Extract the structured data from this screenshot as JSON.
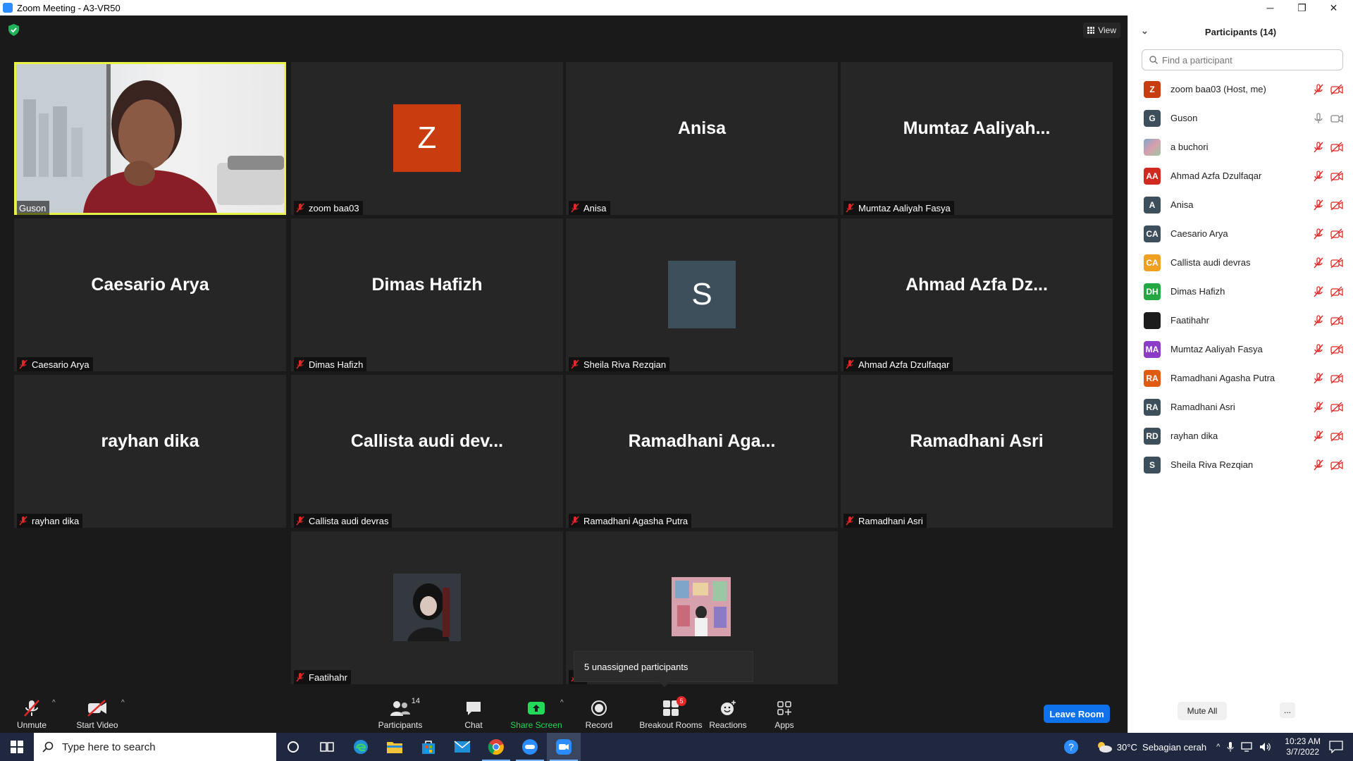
{
  "window": {
    "title": "Zoom Meeting - A3-VR50",
    "controls": [
      "─",
      "❐",
      "✕"
    ]
  },
  "view_button": {
    "label": "View"
  },
  "tiles": [
    {
      "label": "Guson",
      "big_name": "",
      "type": "video",
      "active": true
    },
    {
      "label": "zoom baa03",
      "big_name": "",
      "type": "avatar",
      "avatar_letter": "Z",
      "avatar_color": "#c83c10"
    },
    {
      "label": "Anisa",
      "big_name": "Anisa",
      "type": "name"
    },
    {
      "label": "Mumtaz Aaliyah Fasya",
      "big_name": "Mumtaz  Aaliyah...",
      "type": "name"
    },
    {
      "label": "Caesario Arya",
      "big_name": "Caesario Arya",
      "type": "name"
    },
    {
      "label": "Dimas Hafizh",
      "big_name": "Dimas Hafizh",
      "type": "name"
    },
    {
      "label": "Sheila Riva Rezqian",
      "big_name": "",
      "type": "avatar",
      "avatar_letter": "S",
      "avatar_color": "#3e4f5c"
    },
    {
      "label": "Ahmad Azfa Dzulfaqar",
      "big_name": "Ahmad  Azfa  Dz...",
      "type": "name"
    },
    {
      "label": "rayhan dika",
      "big_name": "rayhan dika",
      "type": "name"
    },
    {
      "label": "Callista audi devras",
      "big_name": "Callista audi dev...",
      "type": "name"
    },
    {
      "label": "Ramadhani Agasha Putra",
      "big_name": "Ramadhani  Aga...",
      "type": "name"
    },
    {
      "label": "Ramadhani Asri",
      "big_name": "Ramadhani Asri",
      "type": "name"
    },
    {
      "label": "Faatihahr",
      "big_name": "",
      "type": "image-avatar",
      "avatar_color": "#2a2f33"
    },
    {
      "label": "",
      "big_name": "",
      "type": "image-avatar",
      "avatar_color": "#c98a9a"
    }
  ],
  "tooltip": {
    "text": "5 unassigned participants"
  },
  "toolbar": {
    "unmute": "Unmute",
    "start_video": "Start Video",
    "participants": "Participants",
    "participants_count": "14",
    "chat": "Chat",
    "share_screen": "Share Screen",
    "record": "Record",
    "breakout_rooms": "Breakout Rooms",
    "breakout_badge": "5",
    "reactions": "Reactions",
    "apps": "Apps",
    "leave_room": "Leave Room"
  },
  "panel": {
    "title": "Participants (14)",
    "search_placeholder": "Find a participant",
    "mute_all": "Mute All",
    "more": "...",
    "participants": [
      {
        "initials": "Z",
        "name": "zoom baa03 (Host, me)",
        "color": "#c83c10",
        "muted": true
      },
      {
        "initials": "G",
        "name": "Guson",
        "color": "#3e4f5c",
        "muted": false
      },
      {
        "initials": "",
        "name": "a buchori",
        "color": "#c98a9a",
        "muted": true,
        "image": true
      },
      {
        "initials": "AA",
        "name": "Ahmad Azfa Dzulfaqar",
        "color": "#d1281f",
        "muted": true
      },
      {
        "initials": "A",
        "name": "Anisa",
        "color": "#3e4f5c",
        "muted": true
      },
      {
        "initials": "CA",
        "name": "Caesario Arya",
        "color": "#3e4f5c",
        "muted": true
      },
      {
        "initials": "CA",
        "name": "Callista audi devras",
        "color": "#f0a020",
        "muted": true
      },
      {
        "initials": "DH",
        "name": "Dimas Hafizh",
        "color": "#24a844",
        "muted": true
      },
      {
        "initials": "",
        "name": "Faatihahr",
        "color": "#1c1c1c",
        "muted": true,
        "image": true
      },
      {
        "initials": "MA",
        "name": "Mumtaz Aaliyah Fasya",
        "color": "#8d3cc8",
        "muted": true
      },
      {
        "initials": "RA",
        "name": "Ramadhani Agasha Putra",
        "color": "#e05a10",
        "muted": true
      },
      {
        "initials": "RA",
        "name": "Ramadhani Asri",
        "color": "#3e4f5c",
        "muted": true
      },
      {
        "initials": "RD",
        "name": "rayhan dika",
        "color": "#3e4f5c",
        "muted": true
      },
      {
        "initials": "S",
        "name": "Sheila Riva Rezqian",
        "color": "#3e4f5c",
        "muted": true
      }
    ]
  },
  "taskbar": {
    "search_placeholder": "Type here to search",
    "weather": "30°C  Sebagian cerah",
    "time": "10:23 AM",
    "date": "3/7/2022"
  },
  "colors": {
    "accent": "#0e72ed",
    "muted_red": "#e02828",
    "active_border": "#e9f246",
    "share_green": "#23d959"
  }
}
